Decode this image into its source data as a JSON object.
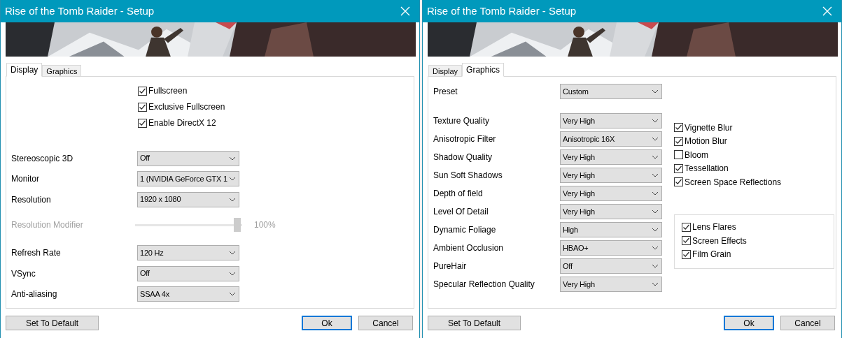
{
  "windows": [
    {
      "title": "Rise of the Tomb Raider - Setup",
      "banner": {
        "kind": "picture"
      },
      "tabs": [
        {
          "label": "Display",
          "selected": true
        },
        {
          "label": "Graphics",
          "selected": false
        }
      ],
      "checkboxes": [
        {
          "label": "Fullscreen",
          "checked": true
        },
        {
          "label": "Exclusive Fullscreen",
          "checked": true
        },
        {
          "label": "Enable DirectX 12",
          "checked": true
        }
      ],
      "settings": [
        {
          "kind": "select",
          "label": "Stereoscopic 3D",
          "value": "Off"
        },
        {
          "kind": "select",
          "label": "Monitor",
          "value": "1 (NVIDIA GeForce GTX 1"
        },
        {
          "kind": "select",
          "label": "Resolution",
          "value": "1920 x 1080"
        },
        {
          "kind": "slider",
          "label": "Resolution Modifier",
          "level": 1,
          "reading": "100%",
          "disabled": true
        },
        {
          "kind": "select",
          "label": "Refresh Rate",
          "value": "120 Hz"
        },
        {
          "kind": "select",
          "label": "VSync",
          "value": "Off"
        },
        {
          "kind": "select",
          "label": "Anti-aliasing",
          "value": "SSAA 4x"
        }
      ],
      "buttons": [
        {
          "label": "Set To Default",
          "default": false
        },
        {
          "label": "Ok",
          "default": true
        },
        {
          "label": "Cancel",
          "default": false
        }
      ]
    },
    {
      "title": "Rise of the Tomb Raider - Setup",
      "banner": {
        "kind": "picture"
      },
      "tabs": [
        {
          "label": "Display",
          "selected": false
        },
        {
          "label": "Graphics",
          "selected": true
        }
      ],
      "preset": {
        "label": "Preset",
        "value": "Custom"
      },
      "settings": [
        {
          "kind": "select",
          "label": "Texture Quality",
          "value": "Very High"
        },
        {
          "kind": "select",
          "label": "Anisotropic Filter",
          "value": "Anisotropic 16X"
        },
        {
          "kind": "select",
          "label": "Shadow Quality",
          "value": "Very High"
        },
        {
          "kind": "select",
          "label": "Sun Soft Shadows",
          "value": "Very High"
        },
        {
          "kind": "select",
          "label": "Depth of field",
          "value": "Very High"
        },
        {
          "kind": "select",
          "label": "Level Of Detail",
          "value": "Very High"
        },
        {
          "kind": "select",
          "label": "Dynamic Foliage",
          "value": "High"
        },
        {
          "kind": "select",
          "label": "Ambient Occlusion",
          "value": "HBAO+"
        },
        {
          "kind": "select",
          "label": "PureHair",
          "value": "Off"
        },
        {
          "kind": "select",
          "label": "Specular Reflection Quality",
          "value": "Very High"
        }
      ],
      "checkboxes": [
        {
          "label": "Vignette Blur",
          "checked": true
        },
        {
          "label": "Motion Blur",
          "checked": true
        },
        {
          "label": "Bloom",
          "checked": false
        },
        {
          "label": "Tessellation",
          "checked": true
        },
        {
          "label": "Screen Space Reflections",
          "checked": true
        }
      ],
      "group_checkboxes": [
        {
          "label": "Lens Flares",
          "checked": true
        },
        {
          "label": "Screen Effects",
          "checked": true
        },
        {
          "label": "Film Grain",
          "checked": true
        }
      ],
      "buttons": [
        {
          "label": "Set To Default",
          "default": false
        },
        {
          "label": "Ok",
          "default": true
        },
        {
          "label": "Cancel",
          "default": false
        }
      ]
    }
  ]
}
